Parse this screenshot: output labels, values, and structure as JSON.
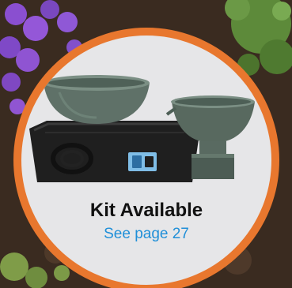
{
  "badge": {
    "title": "Kit Available",
    "link_text": "See page 27",
    "ring_color": "#e8772e",
    "fill_color": "#e6e6e8",
    "title_color": "#111111",
    "link_color": "#1f8fd8"
  },
  "scene": {
    "flower_color": "#8a4fd0",
    "foliage_color": "#5f8a3a",
    "mulch_color": "#3a2b20",
    "fountain_color": "#5f7168",
    "basin_color": "#1f1f1f"
  }
}
